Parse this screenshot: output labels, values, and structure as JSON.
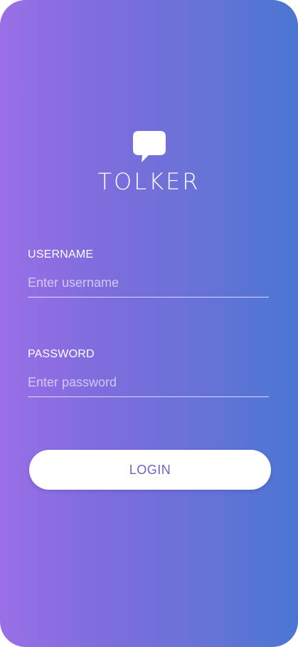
{
  "brand": {
    "name": "TOLKER",
    "logo_icon": "speech-bubble-icon"
  },
  "form": {
    "username": {
      "label": "USERNAME",
      "placeholder": "Enter username",
      "value": ""
    },
    "password": {
      "label": "PASSWORD",
      "placeholder": "Enter password",
      "value": ""
    },
    "login_label": "LOGIN"
  },
  "colors": {
    "gradient_start": "#9a6fe6",
    "gradient_end": "#4a76d2",
    "button_text": "#6a63cc",
    "text": "#ffffff"
  }
}
